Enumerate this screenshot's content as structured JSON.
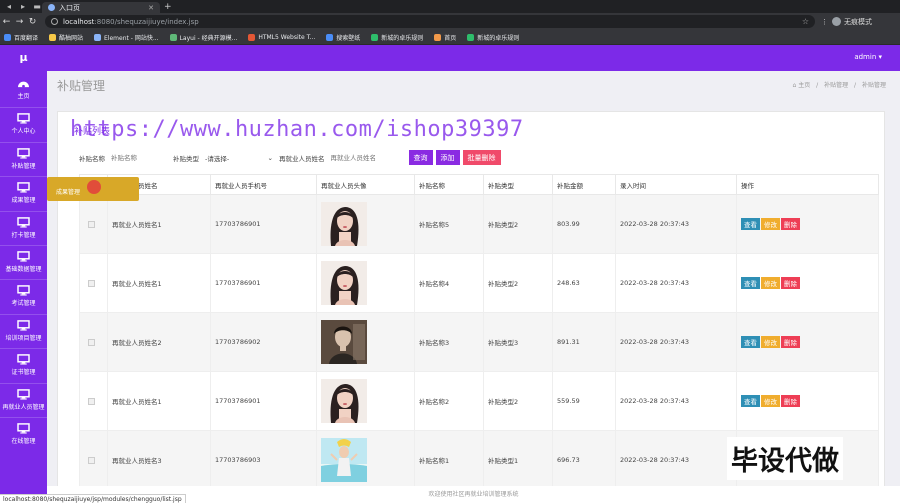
{
  "browser": {
    "tab_title": "入口页",
    "url_host": "localhost",
    "url_rest": ":8080/shequzaijiuye/index.jsp",
    "profile_label": "无痕模式",
    "bookmarks": [
      "百度翻译",
      "酷柚网站",
      "Element - 网站快...",
      "Layui - 经典开源模...",
      "HTML5 Website T...",
      "搜索壁纸",
      "新城的卓乐规则",
      "首页",
      "新城的卓乐规则"
    ]
  },
  "app": {
    "logo": "μ",
    "admin_label": "admin ▾",
    "sidebar": [
      {
        "label": "主页"
      },
      {
        "label": "个人中心"
      },
      {
        "label": "补贴管理"
      },
      {
        "label": "成果管理"
      },
      {
        "label": "打卡管理"
      },
      {
        "label": "基础数据管理"
      },
      {
        "label": "考试管理"
      },
      {
        "label": "培训项目管理"
      },
      {
        "label": "证书管理"
      },
      {
        "label": "再就业人员管理"
      },
      {
        "label": "在线管理"
      }
    ],
    "dropdown_item": "成果管理",
    "page_title": "补贴管理",
    "breadcrumb": [
      "⌂ 主页",
      "/",
      "补贴管理",
      "/",
      "补贴管理"
    ],
    "panel_title": "补贴列表",
    "search": {
      "label_name": "补贴名称",
      "placeholder_name": "补贴名称",
      "label_type": "补贴类型",
      "select_value": "-请选择-",
      "label_person": "再就业人员姓名",
      "placeholder_person": "再就业人员姓名",
      "btn_search": "查询",
      "btn_add": "添加",
      "btn_batch_delete": "批量删除"
    },
    "table": {
      "headers": [
        "",
        "再就业人员姓名",
        "再就业人员手机号",
        "再就业人员头像",
        "补贴名称",
        "补贴类型",
        "补贴金额",
        "录入时间",
        "操作"
      ],
      "rows": [
        {
          "name": "再就业人员姓名1",
          "phone": "17703786901",
          "subsidy": "补贴名称5",
          "type": "补贴类型2",
          "amount": "803.99",
          "time": "2022-03-28 20:37:43",
          "avatar": "girl"
        },
        {
          "name": "再就业人员姓名1",
          "phone": "17703786901",
          "subsidy": "补贴名称4",
          "type": "补贴类型2",
          "amount": "248.63",
          "time": "2022-03-28 20:37:43",
          "avatar": "girl"
        },
        {
          "name": "再就业人员姓名2",
          "phone": "17703786902",
          "subsidy": "补贴名称3",
          "type": "补贴类型3",
          "amount": "891.31",
          "time": "2022-03-28 20:37:43",
          "avatar": "man"
        },
        {
          "name": "再就业人员姓名1",
          "phone": "17703786901",
          "subsidy": "补贴名称2",
          "type": "补贴类型2",
          "amount": "559.59",
          "time": "2022-03-28 20:37:43",
          "avatar": "girl"
        },
        {
          "name": "再就业人员姓名3",
          "phone": "17703786903",
          "subsidy": "补贴名称1",
          "type": "补贴类型1",
          "amount": "696.73",
          "time": "2022-03-28 20:37:43",
          "avatar": "beach"
        }
      ],
      "ops": {
        "view": "查看",
        "edit": "修改",
        "delete": "删除"
      }
    },
    "footer": "欢迎使用社区再就业培训管理系统"
  },
  "overlay": {
    "watermark": "https://www.huzhan.com/ishop39397",
    "brand_stamp": "毕设代做",
    "status_url": "localhost:8080/shequzaijiuye/jsp/modules/chengguo/list.jsp"
  },
  "colors": {
    "primary": "#7c2ae8",
    "view": "#2e8fb5",
    "edit": "#f0ad2e",
    "delete": "#ee3e55"
  }
}
